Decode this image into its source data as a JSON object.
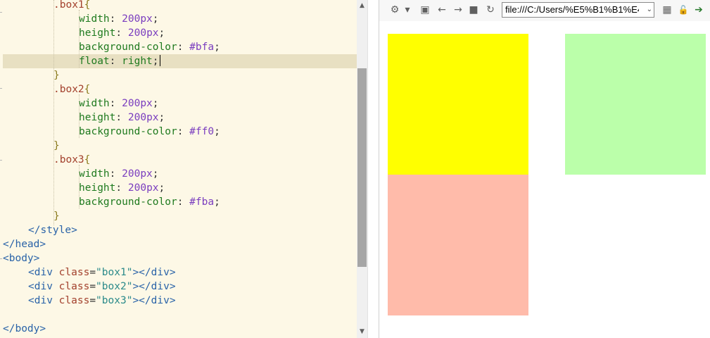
{
  "editor": {
    "lines": [
      {
        "indent": 76,
        "tokens": [
          {
            "c": "sel",
            "t": ".box1"
          },
          {
            "c": "brace",
            "t": "{"
          }
        ]
      },
      {
        "indent": 112,
        "tokens": [
          {
            "c": "prop",
            "t": "width"
          },
          {
            "c": "punct",
            "t": ": "
          },
          {
            "c": "num",
            "t": "200"
          },
          {
            "c": "unit",
            "t": "px"
          },
          {
            "c": "punct",
            "t": ";"
          }
        ]
      },
      {
        "indent": 112,
        "tokens": [
          {
            "c": "prop",
            "t": "height"
          },
          {
            "c": "punct",
            "t": ": "
          },
          {
            "c": "num",
            "t": "200"
          },
          {
            "c": "unit",
            "t": "px"
          },
          {
            "c": "punct",
            "t": ";"
          }
        ]
      },
      {
        "indent": 112,
        "tokens": [
          {
            "c": "prop",
            "t": "background-color"
          },
          {
            "c": "punct",
            "t": ": "
          },
          {
            "c": "hex",
            "t": "#bfa"
          },
          {
            "c": "punct",
            "t": ";"
          }
        ]
      },
      {
        "indent": 112,
        "active": true,
        "caret": true,
        "tokens": [
          {
            "c": "prop",
            "t": "float"
          },
          {
            "c": "punct",
            "t": ": "
          },
          {
            "c": "kw",
            "t": "right"
          },
          {
            "c": "punct",
            "t": ";"
          }
        ]
      },
      {
        "indent": 76,
        "tokens": [
          {
            "c": "brace",
            "t": "}"
          }
        ]
      },
      {
        "indent": 76,
        "tokens": [
          {
            "c": "sel",
            "t": ".box2"
          },
          {
            "c": "brace",
            "t": "{"
          }
        ]
      },
      {
        "indent": 112,
        "tokens": [
          {
            "c": "prop",
            "t": "width"
          },
          {
            "c": "punct",
            "t": ": "
          },
          {
            "c": "num",
            "t": "200"
          },
          {
            "c": "unit",
            "t": "px"
          },
          {
            "c": "punct",
            "t": ";"
          }
        ]
      },
      {
        "indent": 112,
        "tokens": [
          {
            "c": "prop",
            "t": "height"
          },
          {
            "c": "punct",
            "t": ": "
          },
          {
            "c": "num",
            "t": "200"
          },
          {
            "c": "unit",
            "t": "px"
          },
          {
            "c": "punct",
            "t": ";"
          }
        ]
      },
      {
        "indent": 112,
        "tokens": [
          {
            "c": "prop",
            "t": "background-color"
          },
          {
            "c": "punct",
            "t": ": "
          },
          {
            "c": "hex",
            "t": "#ff0"
          },
          {
            "c": "punct",
            "t": ";"
          }
        ]
      },
      {
        "indent": 76,
        "tokens": [
          {
            "c": "brace",
            "t": "}"
          }
        ]
      },
      {
        "indent": 76,
        "tokens": [
          {
            "c": "sel",
            "t": ".box3"
          },
          {
            "c": "brace",
            "t": "{"
          }
        ]
      },
      {
        "indent": 112,
        "tokens": [
          {
            "c": "prop",
            "t": "width"
          },
          {
            "c": "punct",
            "t": ": "
          },
          {
            "c": "num",
            "t": "200"
          },
          {
            "c": "unit",
            "t": "px"
          },
          {
            "c": "punct",
            "t": ";"
          }
        ]
      },
      {
        "indent": 112,
        "tokens": [
          {
            "c": "prop",
            "t": "height"
          },
          {
            "c": "punct",
            "t": ": "
          },
          {
            "c": "num",
            "t": "200"
          },
          {
            "c": "unit",
            "t": "px"
          },
          {
            "c": "punct",
            "t": ";"
          }
        ]
      },
      {
        "indent": 112,
        "tokens": [
          {
            "c": "prop",
            "t": "background-color"
          },
          {
            "c": "punct",
            "t": ": "
          },
          {
            "c": "hex",
            "t": "#fba"
          },
          {
            "c": "punct",
            "t": ";"
          }
        ]
      },
      {
        "indent": 76,
        "tokens": [
          {
            "c": "brace",
            "t": "}"
          }
        ]
      },
      {
        "indent": 40,
        "tokens": [
          {
            "c": "tag",
            "t": "</style>"
          }
        ]
      },
      {
        "indent": 4,
        "tokens": [
          {
            "c": "tag",
            "t": "</head>"
          }
        ]
      },
      {
        "indent": 4,
        "tokens": [
          {
            "c": "tag",
            "t": "<body>"
          }
        ]
      },
      {
        "indent": 40,
        "tokens": [
          {
            "c": "tag",
            "t": "<div "
          },
          {
            "c": "attr",
            "t": "class"
          },
          {
            "c": "punct",
            "t": "="
          },
          {
            "c": "str",
            "t": "\"box1\""
          },
          {
            "c": "tag",
            "t": "></div>"
          }
        ]
      },
      {
        "indent": 40,
        "tokens": [
          {
            "c": "tag",
            "t": "<div "
          },
          {
            "c": "attr",
            "t": "class"
          },
          {
            "c": "punct",
            "t": "="
          },
          {
            "c": "str",
            "t": "\"box2\""
          },
          {
            "c": "tag",
            "t": "></div>"
          }
        ]
      },
      {
        "indent": 40,
        "tokens": [
          {
            "c": "tag",
            "t": "<div "
          },
          {
            "c": "attr",
            "t": "class"
          },
          {
            "c": "punct",
            "t": "="
          },
          {
            "c": "str",
            "t": "\"box3\""
          },
          {
            "c": "tag",
            "t": "></div>"
          }
        ]
      },
      {
        "indent": 4,
        "tokens": []
      },
      {
        "indent": 4,
        "tokens": [
          {
            "c": "tag",
            "t": "</body>"
          }
        ]
      }
    ]
  },
  "browser": {
    "toolbar_icons": [
      {
        "name": "gear-icon",
        "glyph": "⚙"
      },
      {
        "name": "dropdown-arrow-icon",
        "glyph": "▾"
      },
      {
        "name": "console-icon",
        "glyph": "▣"
      },
      {
        "name": "back-arrow-icon",
        "glyph": "←"
      },
      {
        "name": "forward-arrow-icon",
        "glyph": "→"
      },
      {
        "name": "stop-icon",
        "glyph": "■"
      },
      {
        "name": "refresh-icon",
        "glyph": "↻"
      }
    ],
    "url": "file:///C:/Users/%E5%B1%B1%E4%",
    "right_icons": [
      {
        "name": "qr-code-icon",
        "glyph": "▦"
      },
      {
        "name": "lock-icon",
        "glyph": "🔓"
      },
      {
        "name": "go-arrow-icon",
        "glyph": "➔"
      }
    ],
    "boxes": [
      {
        "name": "box1-green",
        "class": "box1",
        "color": "#bbffaa"
      },
      {
        "name": "box2-yellow",
        "class": "box2",
        "color": "#ffff00"
      },
      {
        "name": "box3-salmon",
        "class": "box3",
        "color": "#ffbbaa"
      }
    ]
  }
}
